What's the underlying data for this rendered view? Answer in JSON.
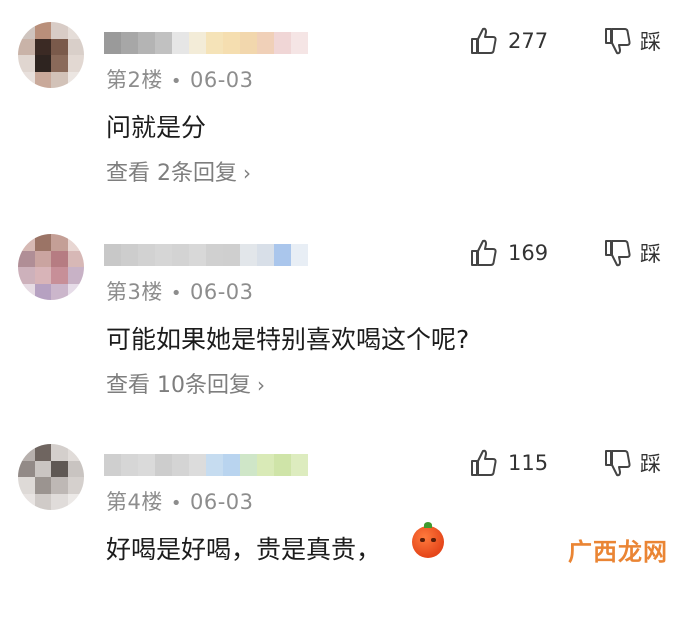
{
  "comments": [
    {
      "floor": "第2楼",
      "date": "06-03",
      "text": "问就是分",
      "replies": "查看 2条回复",
      "likes": "277",
      "dislike_label": "踩",
      "avatar_pixels": [
        "#cfc4be",
        "#b98f7a",
        "#d8ccc6",
        "#e5ddd8",
        "#c9b3a8",
        "#3b2a24",
        "#7a5a4b",
        "#d9cfc9",
        "#e0d6d0",
        "#2e2420",
        "#8a6a5a",
        "#e2d8d2",
        "#e8e0dc",
        "#c9a99a",
        "#d2c2b8",
        "#ece6e2"
      ],
      "name_pixels": [
        "#9a9a9a",
        "#a7a7a7",
        "#b4b4b4",
        "#c1c1c1",
        "#e6e6e6",
        "#f3ecd8",
        "#f5e3b8",
        "#f5deb0",
        "#f2d7ad",
        "#f0d0b8",
        "#f0d6d6",
        "#f5e5e5"
      ]
    },
    {
      "floor": "第3楼",
      "date": "06-03",
      "text": "可能如果她是特别喜欢喝这个呢?",
      "replies": "查看 10条回复",
      "likes": "169",
      "dislike_label": "踩",
      "avatar_pixels": [
        "#d6b9b4",
        "#9b7466",
        "#c49f96",
        "#e8d6d2",
        "#b08e96",
        "#caa4a0",
        "#b67c82",
        "#d7b8b6",
        "#cdb1bb",
        "#d8b4b8",
        "#c78f98",
        "#c8b2c6",
        "#e6dbe3",
        "#b6a1c1",
        "#cbb6cb",
        "#e6dce8"
      ],
      "name_pixels": [
        "#c8c8c8",
        "#cdcdcd",
        "#d2d2d2",
        "#d6d6d6",
        "#d3d3d3",
        "#d8d8d8",
        "#d0d0d0",
        "#cfcfcf",
        "#e2e6ea",
        "#d8dfe8",
        "#aac6ec",
        "#e8eef5"
      ]
    },
    {
      "floor": "第4楼",
      "date": "06-03",
      "text": "好喝是好喝，贵是真贵，",
      "replies": "",
      "likes": "115",
      "dislike_label": "踩",
      "avatar_pixels": [
        "#b7b0ad",
        "#6f6560",
        "#d4cfcc",
        "#e1dcd9",
        "#928a87",
        "#cac5c2",
        "#5f5854",
        "#c9c4c1",
        "#dedad7",
        "#9b9490",
        "#beb8b5",
        "#d5d0cd",
        "#e8e4e2",
        "#d0cbc8",
        "#e0dcda",
        "#ece9e7"
      ],
      "name_pixels": [
        "#cfcfcf",
        "#d6d6d6",
        "#dadada",
        "#cdcdcd",
        "#d4d4d4",
        "#dcdcdc",
        "#c6dcf0",
        "#b9d4ef",
        "#cfe6c8",
        "#d9eab7",
        "#cfe4a8",
        "#ddecbf"
      ]
    }
  ],
  "watermark": "广西龙网",
  "colors": {
    "meta": "#8d8d8d",
    "text": "#1c1c1c",
    "watermark": "#e8781f"
  }
}
